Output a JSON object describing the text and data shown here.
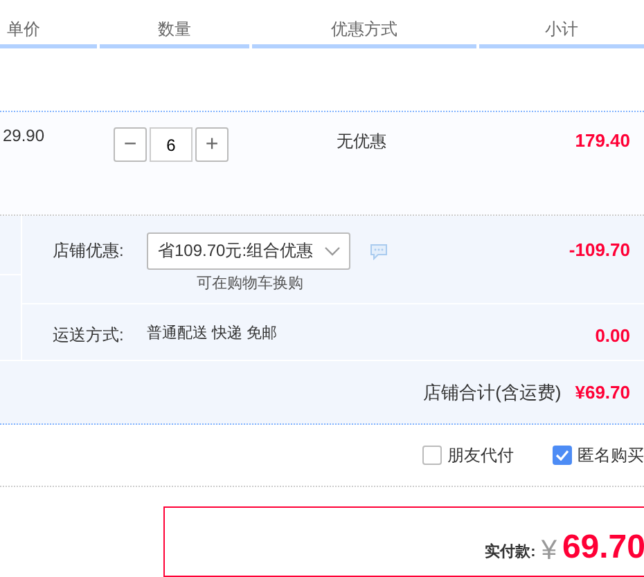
{
  "columns": [
    {
      "label": "单价"
    },
    {
      "label": "数量"
    },
    {
      "label": "优惠方式"
    },
    {
      "label": "小计"
    }
  ],
  "item": {
    "unit_price": "29.90",
    "quantity": "6",
    "minus": "−",
    "plus": "+",
    "discount": "无优惠",
    "subtotal": "179.40"
  },
  "shop_promo": {
    "label": "店铺优惠:",
    "select_value": "省109.70元:组合优惠",
    "note": "可在购物车换购",
    "amount": "-109.70"
  },
  "shipping": {
    "label": "运送方式:",
    "method": "普通配送 快递 免邮",
    "amount": "0.00"
  },
  "shop_total": {
    "label": "店铺合计(含运费)",
    "amount": "¥69.70"
  },
  "options": [
    {
      "label": "朋友代付",
      "checked": false
    },
    {
      "label": "匿名购买",
      "checked": true
    }
  ],
  "payment": {
    "label": "实付款:",
    "currency": "¥",
    "amount": "69.70"
  }
}
